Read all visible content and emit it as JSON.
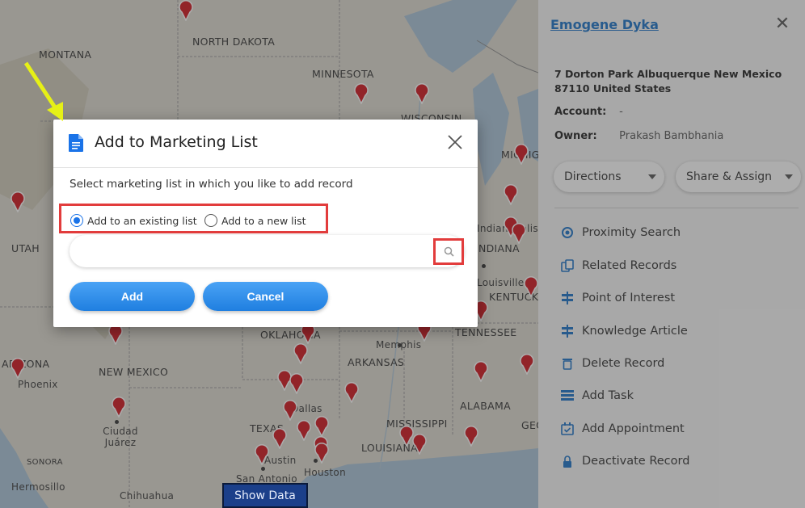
{
  "map": {
    "state_labels": [
      {
        "text": "NORTH DAKOTA"
      },
      {
        "text": "MONTANA"
      },
      {
        "text": "MINNESOTA"
      },
      {
        "text": "WISCONSIN"
      },
      {
        "text": "MICHIGAN"
      },
      {
        "text": "UTAH"
      },
      {
        "text": "INDIANA"
      },
      {
        "text": "KENTUCKY"
      },
      {
        "text": "TENNESSEE"
      },
      {
        "text": "OKLAHOMA"
      },
      {
        "text": "ARKANSAS"
      },
      {
        "text": "NEW MEXICO"
      },
      {
        "text": "ARIZONA"
      },
      {
        "text": "TEXAS"
      },
      {
        "text": "ALABAMA"
      },
      {
        "text": "MISSISSIPPI"
      },
      {
        "text": "LOUISIANA"
      },
      {
        "text": "GEORGIA"
      },
      {
        "text": "SONORA"
      }
    ],
    "city_labels": [
      {
        "text": "Indianapolis"
      },
      {
        "text": "Louisville"
      },
      {
        "text": "Memphis"
      },
      {
        "text": "Phoenix"
      },
      {
        "text": "Ciudad Juárez"
      },
      {
        "text": "Dallas"
      },
      {
        "text": "Austin"
      },
      {
        "text": "Houston"
      },
      {
        "text": "San Antonio"
      },
      {
        "text": "Chihuahua"
      },
      {
        "text": "Hermosillo"
      }
    ],
    "show_data_label": "Show Data",
    "pin_color": "#d0141c"
  },
  "panel": {
    "record_name": "Emogene Dyka",
    "address": "7 Dorton Park Albuquerque New Mexico 87110 United States",
    "account_label": "Account:",
    "account_value": "-",
    "owner_label": "Owner:",
    "owner_value": "Prakash Bambhania",
    "directions_label": "Directions",
    "share_label": "Share & Assign",
    "actions": [
      {
        "label": "Proximity Search",
        "icon": "target-icon"
      },
      {
        "label": "Related Records",
        "icon": "related-records-icon"
      },
      {
        "label": "Point of Interest",
        "icon": "signpost-icon"
      },
      {
        "label": "Knowledge Article",
        "icon": "signpost-icon"
      },
      {
        "label": "Delete Record",
        "icon": "trash-icon"
      },
      {
        "label": "Add Task",
        "icon": "task-list-icon"
      },
      {
        "label": "Add Appointment",
        "icon": "calendar-check-icon"
      },
      {
        "label": "Deactivate Record",
        "icon": "lock-icon"
      }
    ]
  },
  "modal": {
    "title": "Add to Marketing List",
    "description": "Select marketing list in which you like to add record",
    "option_existing": "Add to an existing list",
    "option_new": "Add to a new list",
    "selected_option": "existing",
    "search_value": "",
    "add_label": "Add",
    "cancel_label": "Cancel",
    "accent_color": "#1a73e8",
    "highlight_color": "#e23c3c"
  }
}
